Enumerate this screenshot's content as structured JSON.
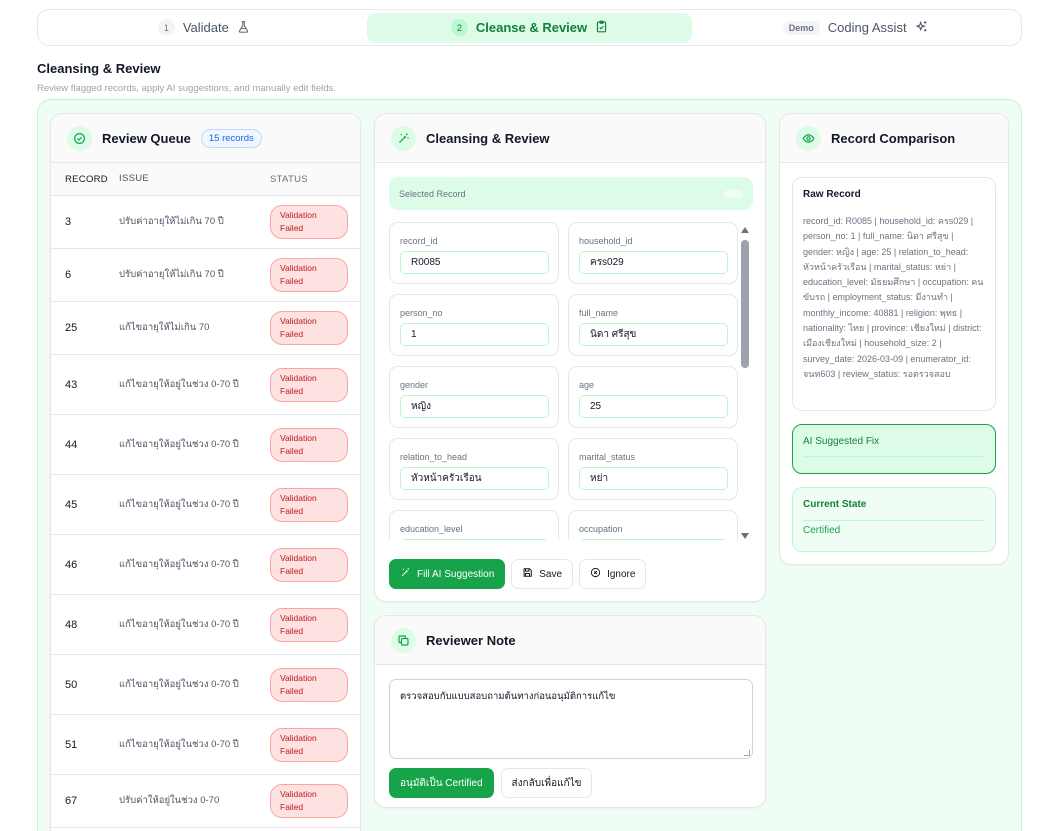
{
  "stepper": {
    "steps": [
      {
        "num": "1",
        "label": "Validate",
        "icon": "flask-icon"
      },
      {
        "num": "2",
        "label": "Cleanse & Review",
        "icon": "clipboard-check-icon"
      },
      {
        "badge": "Demo",
        "label": "Coding Assist",
        "icon": "sparkles-icon"
      }
    ]
  },
  "page": {
    "title": "Cleansing & Review",
    "subtitle": "Review flagged records, apply AI suggestions, and manually edit fields."
  },
  "queue": {
    "title": "Review Queue",
    "count_badge": "15 records",
    "headers": {
      "record": "RECORD",
      "issue": "ISSUE",
      "status": "STATUS"
    },
    "rows": [
      {
        "record": "3",
        "issue": "ปรับค่าอายุให้ไม่เกิน 70 ปี",
        "status": "Validation Failed"
      },
      {
        "record": "6",
        "issue": "ปรับค่าอายุให้ไม่เกิน 70 ปี",
        "status": "Validation Failed"
      },
      {
        "record": "25",
        "issue": "แก้ไขอายุให้ไม่เกิน 70",
        "status": "Validation Failed"
      },
      {
        "record": "43",
        "issue": "แก้ไขอายุให้อยู่ในช่วง 0-70 ปี",
        "status": "Validation Failed"
      },
      {
        "record": "44",
        "issue": "แก้ไขอายุให้อยู่ในช่วง 0-70 ปี",
        "status": "Validation Failed"
      },
      {
        "record": "45",
        "issue": "แก้ไขอายุให้อยู่ในช่วง 0-70 ปี",
        "status": "Validation Failed"
      },
      {
        "record": "46",
        "issue": "แก้ไขอายุให้อยู่ในช่วง 0-70 ปี",
        "status": "Validation Failed"
      },
      {
        "record": "48",
        "issue": "แก้ไขอายุให้อยู่ในช่วง 0-70 ปี",
        "status": "Validation Failed"
      },
      {
        "record": "50",
        "issue": "แก้ไขอายุให้อยู่ในช่วง 0-70 ปี",
        "status": "Validation Failed"
      },
      {
        "record": "51",
        "issue": "แก้ไขอายุให้อยู่ในช่วง 0-70 ปี",
        "status": "Validation Failed"
      },
      {
        "record": "67",
        "issue": "ปรับค่าให้อยู่ในช่วง 0-70",
        "status": "Validation Failed"
      }
    ]
  },
  "cleanse": {
    "title": "Cleansing & Review",
    "selected_label": "Selected Record",
    "fields": [
      {
        "label": "record_id",
        "value": "R0085"
      },
      {
        "label": "household_id",
        "value": "ครs029"
      },
      {
        "label": "person_no",
        "value": "1"
      },
      {
        "label": "full_name",
        "value": "นิดา ศรีสุข"
      },
      {
        "label": "gender",
        "value": "หญิง"
      },
      {
        "label": "age",
        "value": "25"
      },
      {
        "label": "relation_to_head",
        "value": "หัวหน้าครัวเรือน"
      },
      {
        "label": "marital_status",
        "value": "หย่า"
      },
      {
        "label": "education_level",
        "value": ""
      },
      {
        "label": "occupation",
        "value": ""
      }
    ],
    "buttons": {
      "fill_ai": "Fill AI Suggestion",
      "save": "Save",
      "ignore": "Ignore"
    }
  },
  "note": {
    "title": "Reviewer Note",
    "text": "ตรวจสอบกับแบบสอบถามต้นทางก่อนอนุมัติการแก้ไข",
    "approve_label": "อนุมัติเป็น Certified",
    "return_label": "ส่งกลับเพื่อแก้ไข"
  },
  "comparison": {
    "title": "Record Comparison",
    "raw_title": "Raw Record",
    "raw_text": "record_id: R0085 | household_id: ครs029 | person_no: 1 | full_name: นิดา ศรีสุข | gender: หญิง | age: 25 | relation_to_head: หัวหน้าครัวเรือน | marital_status: หย่า | education_level: มัธยมศึกษา | occupation: คนขับรถ | employment_status: มีงานทำ | monthly_income: 40881 | religion: พุทธ | nationality: ไทย | province: เชียงใหม่ | district: เมืองเชียงใหม่ | household_size: 2 | survey_date: 2026-03-09 | enumerator_id: จนท603 | review_status: รอตรวจสอบ",
    "ai_title": "AI Suggested Fix",
    "state_title": "Current State",
    "state_value": "Certified"
  },
  "colors": {
    "accent": "#16a34a",
    "accent_light": "#dcfce7",
    "danger": "#b91c1c",
    "danger_bg": "#fee2e2",
    "info": "#2563eb"
  }
}
